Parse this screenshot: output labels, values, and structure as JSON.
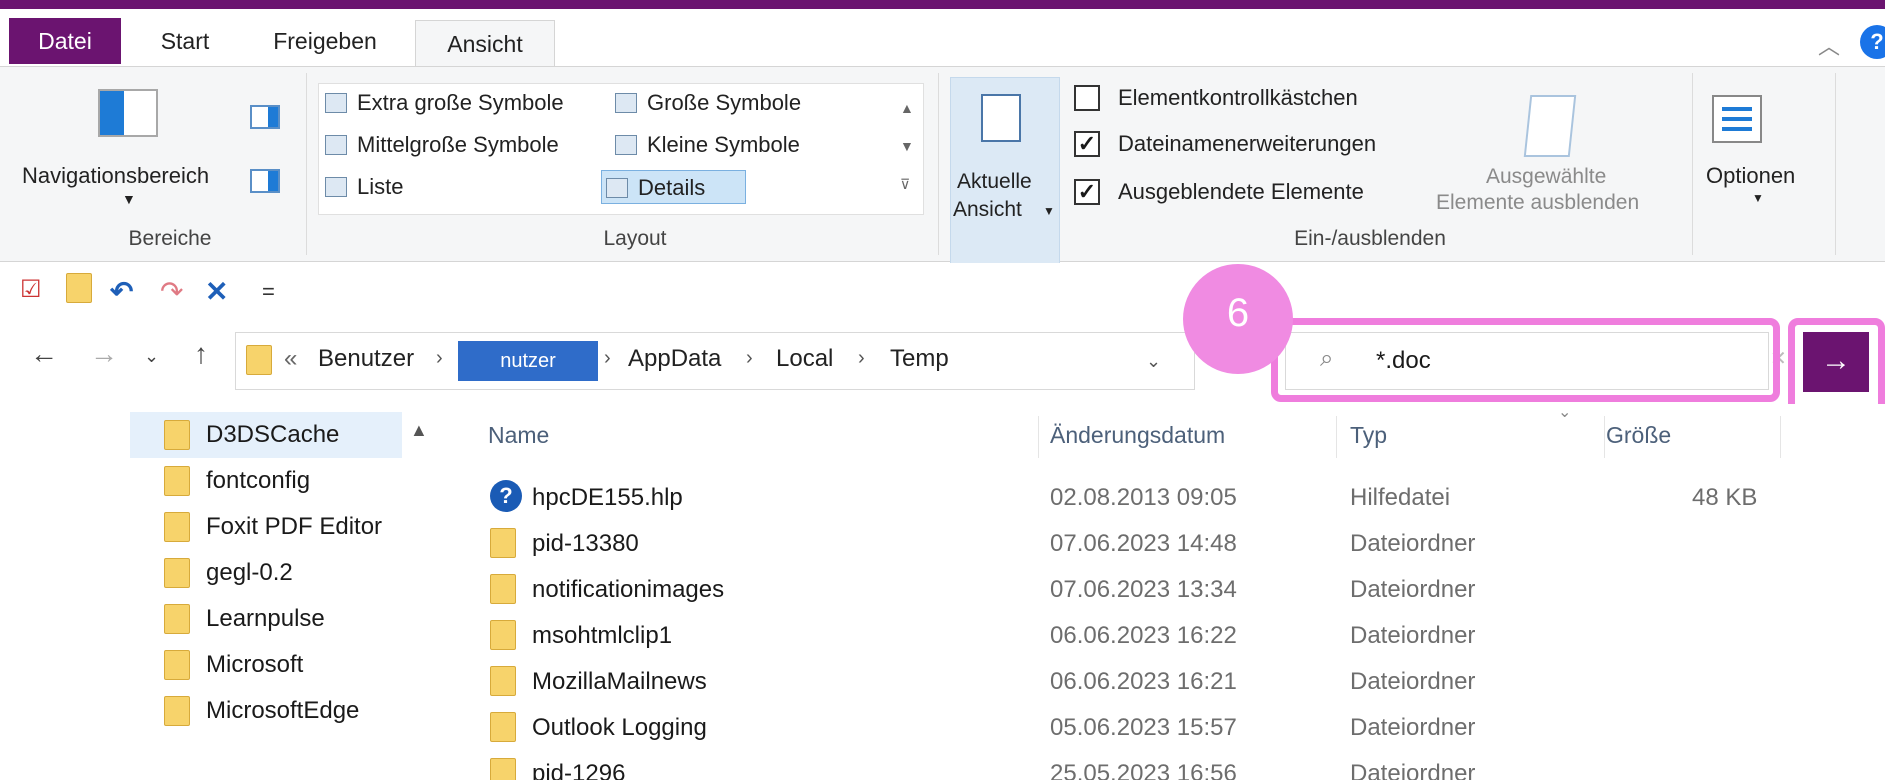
{
  "tabs": {
    "file": "Datei",
    "start": "Start",
    "share": "Freigeben",
    "view": "Ansicht"
  },
  "ribbon": {
    "panes": {
      "navigation_pane": "Navigationsbereich",
      "group_label": "Bereiche"
    },
    "layout": {
      "group_label": "Layout",
      "items": [
        "Extra große Symbole",
        "Große Symbole",
        "Mittelgroße Symbole",
        "Kleine Symbole",
        "Liste",
        "Details"
      ],
      "selected": "Details"
    },
    "current_view": {
      "line1": "Aktuelle",
      "line2": "Ansicht"
    },
    "show_hide": {
      "group_label": "Ein-/ausblenden",
      "checkboxes": [
        {
          "label": "Elementkontrollkästchen",
          "checked": false
        },
        {
          "label": "Dateinamenerweiterungen",
          "checked": true
        },
        {
          "label": "Ausgeblendete Elemente",
          "checked": true
        }
      ],
      "hide_selected_line1": "Ausgewählte",
      "hide_selected_line2": "Elemente ausblenden"
    },
    "options": "Optionen"
  },
  "address": {
    "overflow": "«",
    "crumbs": [
      "Benutzer",
      "nutzer",
      "AppData",
      "Local",
      "Temp"
    ]
  },
  "search": {
    "value": "*.doc"
  },
  "annotation": {
    "badge": "6",
    "color": "#ef7ddd"
  },
  "navtree": {
    "items": [
      "D3DSCache",
      "fontconfig",
      "Foxit PDF Editor",
      "gegl-0.2",
      "Learnpulse",
      "Microsoft",
      "MicrosoftEdge"
    ]
  },
  "list": {
    "headers": [
      "Name",
      "Änderungsdatum",
      "Typ",
      "Größe"
    ],
    "rows": [
      {
        "name": "hpcDE155.hlp",
        "date": "02.08.2013 09:05",
        "type": "Hilfedatei",
        "size": "48 KB",
        "icon": "help-icon"
      },
      {
        "name": "pid-13380",
        "date": "07.06.2023 14:48",
        "type": "Dateiordner",
        "size": "",
        "icon": "folder-icon"
      },
      {
        "name": "notificationimages",
        "date": "07.06.2023 13:34",
        "type": "Dateiordner",
        "size": "",
        "icon": "folder-icon"
      },
      {
        "name": "msohtmlclip1",
        "date": "06.06.2023 16:22",
        "type": "Dateiordner",
        "size": "",
        "icon": "folder-icon"
      },
      {
        "name": "MozillaMailnews",
        "date": "06.06.2023 16:21",
        "type": "Dateiordner",
        "size": "",
        "icon": "folder-icon"
      },
      {
        "name": "Outlook Logging",
        "date": "05.06.2023 15:57",
        "type": "Dateiordner",
        "size": "",
        "icon": "folder-icon"
      },
      {
        "name": "pid-1296",
        "date": "25.05.2023 16:56",
        "type": "Dateiordner",
        "size": "",
        "icon": "folder-icon"
      }
    ]
  },
  "colors": {
    "accent": "#6b1470",
    "selection": "#cce4f7",
    "folder": "#f7d36b"
  }
}
